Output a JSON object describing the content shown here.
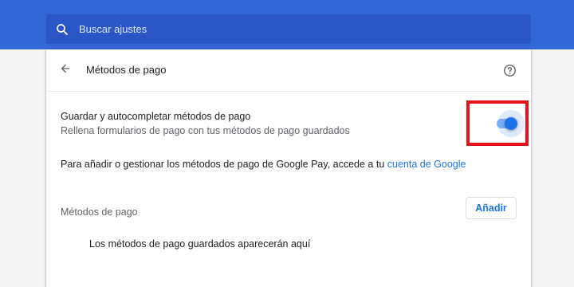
{
  "search": {
    "placeholder": "Buscar ajustes"
  },
  "header": {
    "title": "Métodos de pago"
  },
  "setting": {
    "title": "Guardar y autocompletar métodos de pago",
    "subtitle": "Rellena formularios de pago con tus métodos de pago guardados",
    "toggle_on": true
  },
  "info": {
    "text": "Para añadir o gestionar los métodos de pago de Google Pay, accede a tu ",
    "link": "cuenta de Google"
  },
  "payment_methods": {
    "title": "Métodos de pago",
    "add_label": "Añadir",
    "empty_message": "Los métodos de pago guardados aparecerán aquí"
  },
  "colors": {
    "top_bar": "#3367d6",
    "accent": "#1a73e8",
    "highlight": "#e8121d"
  },
  "icons": {
    "search": "search-icon",
    "back": "arrow-back-icon",
    "help": "help-circle-icon"
  }
}
